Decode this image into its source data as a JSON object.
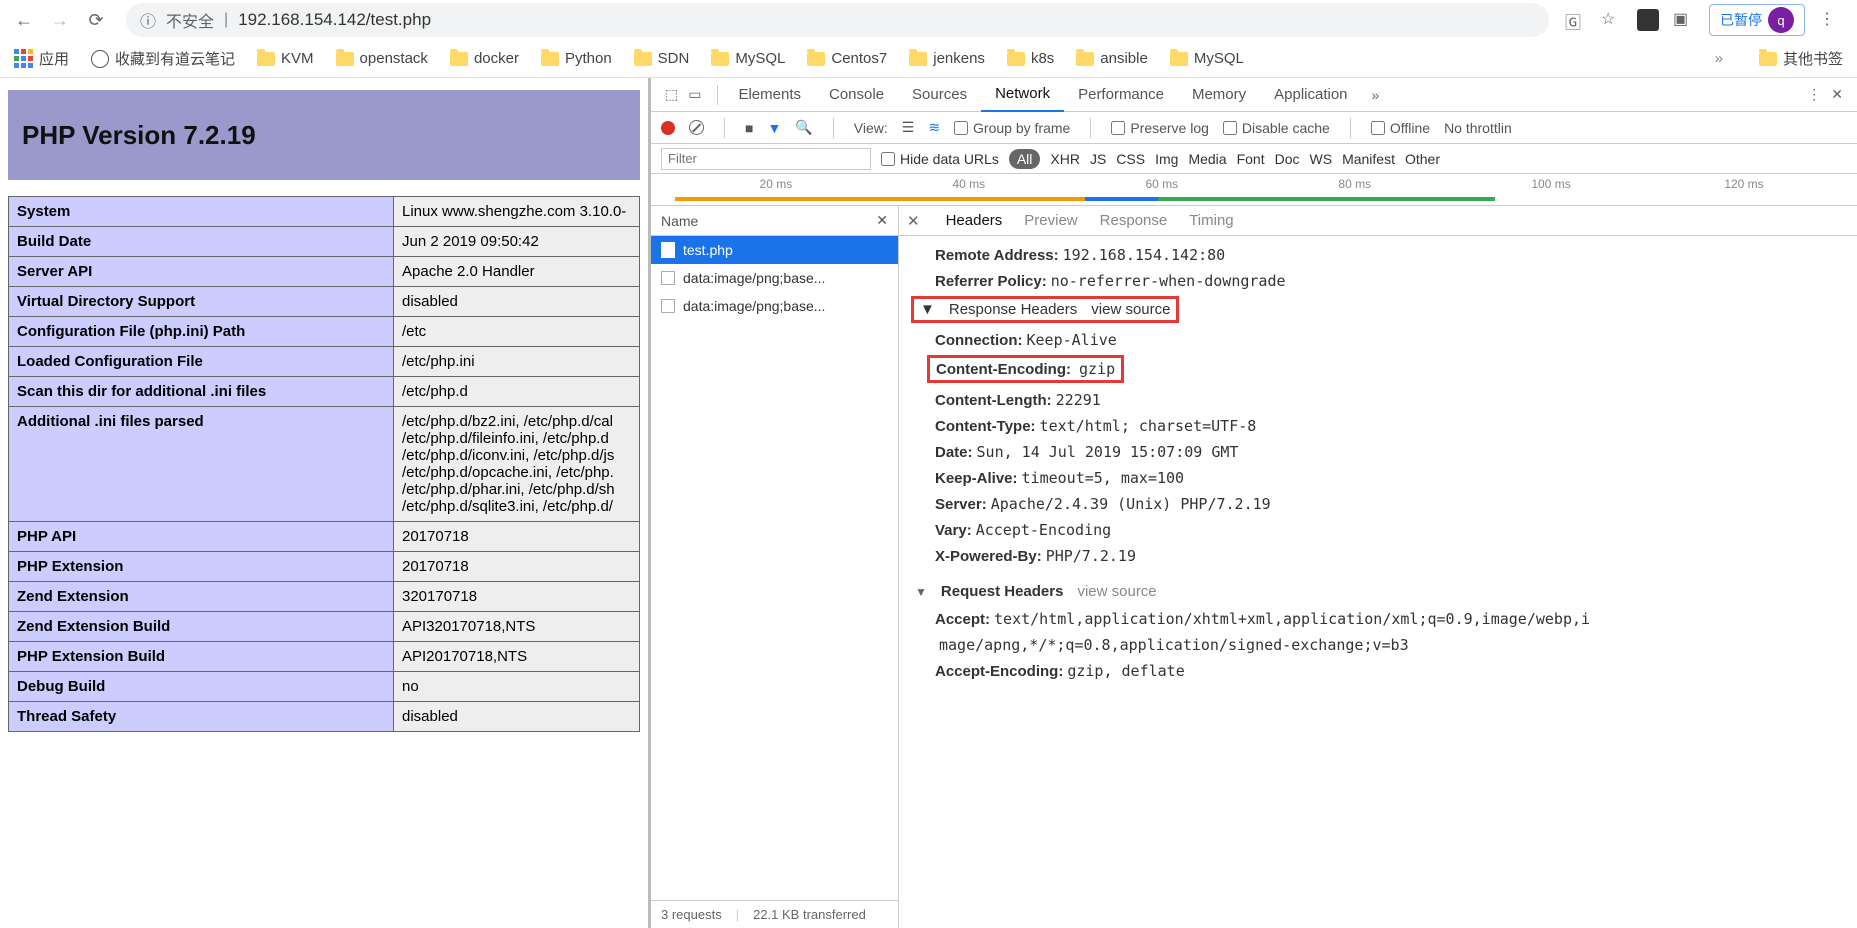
{
  "browser": {
    "insecure": "不安全",
    "url": "192.168.154.142/test.php",
    "paused": "已暂停",
    "avatar": "q"
  },
  "bookmarks": {
    "apps": "应用",
    "youdao": "收藏到有道云笔记",
    "items": [
      "KVM",
      "openstack",
      "docker",
      "Python",
      "SDN",
      "MySQL",
      "Centos7",
      "jenkens",
      "k8s",
      "ansible",
      "MySQL"
    ],
    "more": "»",
    "other": "其他书签"
  },
  "php": {
    "title": "PHP Version 7.2.19",
    "rows": [
      {
        "k": "System",
        "v": "Linux www.shengzhe.com 3.10.0-"
      },
      {
        "k": "Build Date",
        "v": "Jun 2 2019 09:50:42"
      },
      {
        "k": "Server API",
        "v": "Apache 2.0 Handler"
      },
      {
        "k": "Virtual Directory Support",
        "v": "disabled"
      },
      {
        "k": "Configuration File (php.ini) Path",
        "v": "/etc"
      },
      {
        "k": "Loaded Configuration File",
        "v": "/etc/php.ini"
      },
      {
        "k": "Scan this dir for additional .ini files",
        "v": "/etc/php.d"
      },
      {
        "k": "Additional .ini files parsed",
        "v": "/etc/php.d/bz2.ini, /etc/php.d/cal\n/etc/php.d/fileinfo.ini, /etc/php.d\n/etc/php.d/iconv.ini, /etc/php.d/js\n/etc/php.d/opcache.ini, /etc/php.\n/etc/php.d/phar.ini, /etc/php.d/sh\n/etc/php.d/sqlite3.ini, /etc/php.d/"
      },
      {
        "k": "PHP API",
        "v": "20170718"
      },
      {
        "k": "PHP Extension",
        "v": "20170718"
      },
      {
        "k": "Zend Extension",
        "v": "320170718"
      },
      {
        "k": "Zend Extension Build",
        "v": "API320170718,NTS"
      },
      {
        "k": "PHP Extension Build",
        "v": "API20170718,NTS"
      },
      {
        "k": "Debug Build",
        "v": "no"
      },
      {
        "k": "Thread Safety",
        "v": "disabled"
      }
    ]
  },
  "devtools": {
    "tabs": [
      "Elements",
      "Console",
      "Sources",
      "Network",
      "Performance",
      "Memory",
      "Application"
    ],
    "active_tab": "Network",
    "toolbar": {
      "view": "View:",
      "group": "Group by frame",
      "preserve": "Preserve log",
      "disable_cache": "Disable cache",
      "offline": "Offline",
      "throttle": "No throttlin"
    },
    "filter": {
      "placeholder": "Filter",
      "hide": "Hide data URLs",
      "types": [
        "All",
        "XHR",
        "JS",
        "CSS",
        "Img",
        "Media",
        "Font",
        "Doc",
        "WS",
        "Manifest",
        "Other"
      ]
    },
    "timeline_ticks": [
      "20 ms",
      "40 ms",
      "60 ms",
      "80 ms",
      "100 ms",
      "120 ms"
    ],
    "reqlist": {
      "head": "Name",
      "items": [
        "test.php",
        "data:image/png;base...",
        "data:image/png;base..."
      ],
      "status_reqs": "3 requests",
      "status_size": "22.1 KB transferred"
    },
    "detail_tabs": [
      "Headers",
      "Preview",
      "Response",
      "Timing"
    ],
    "headers": {
      "remote_k": "Remote Address:",
      "remote_v": "192.168.154.142:80",
      "refpol_k": "Referrer Policy:",
      "refpol_v": "no-referrer-when-downgrade",
      "resp_section": "Response Headers",
      "view_source": "view source",
      "conn_k": "Connection:",
      "conn_v": "Keep-Alive",
      "cenc_k": "Content-Encoding:",
      "cenc_v": "gzip",
      "clen_k": "Content-Length:",
      "clen_v": "22291",
      "ctype_k": "Content-Type:",
      "ctype_v": "text/html; charset=UTF-8",
      "date_k": "Date:",
      "date_v": "Sun, 14 Jul 2019 15:07:09 GMT",
      "ka_k": "Keep-Alive:",
      "ka_v": "timeout=5, max=100",
      "srv_k": "Server:",
      "srv_v": "Apache/2.4.39 (Unix) PHP/7.2.19",
      "vary_k": "Vary:",
      "vary_v": "Accept-Encoding",
      "xpb_k": "X-Powered-By:",
      "xpb_v": "PHP/7.2.19",
      "req_section": "Request Headers",
      "acc_k": "Accept:",
      "acc_v": "text/html,application/xhtml+xml,application/xml;q=0.9,image/webp,i",
      "acc_v2": "mage/apng,*/*;q=0.8,application/signed-exchange;v=b3",
      "accenc_k": "Accept-Encoding:",
      "accenc_v": "gzip, deflate"
    }
  }
}
